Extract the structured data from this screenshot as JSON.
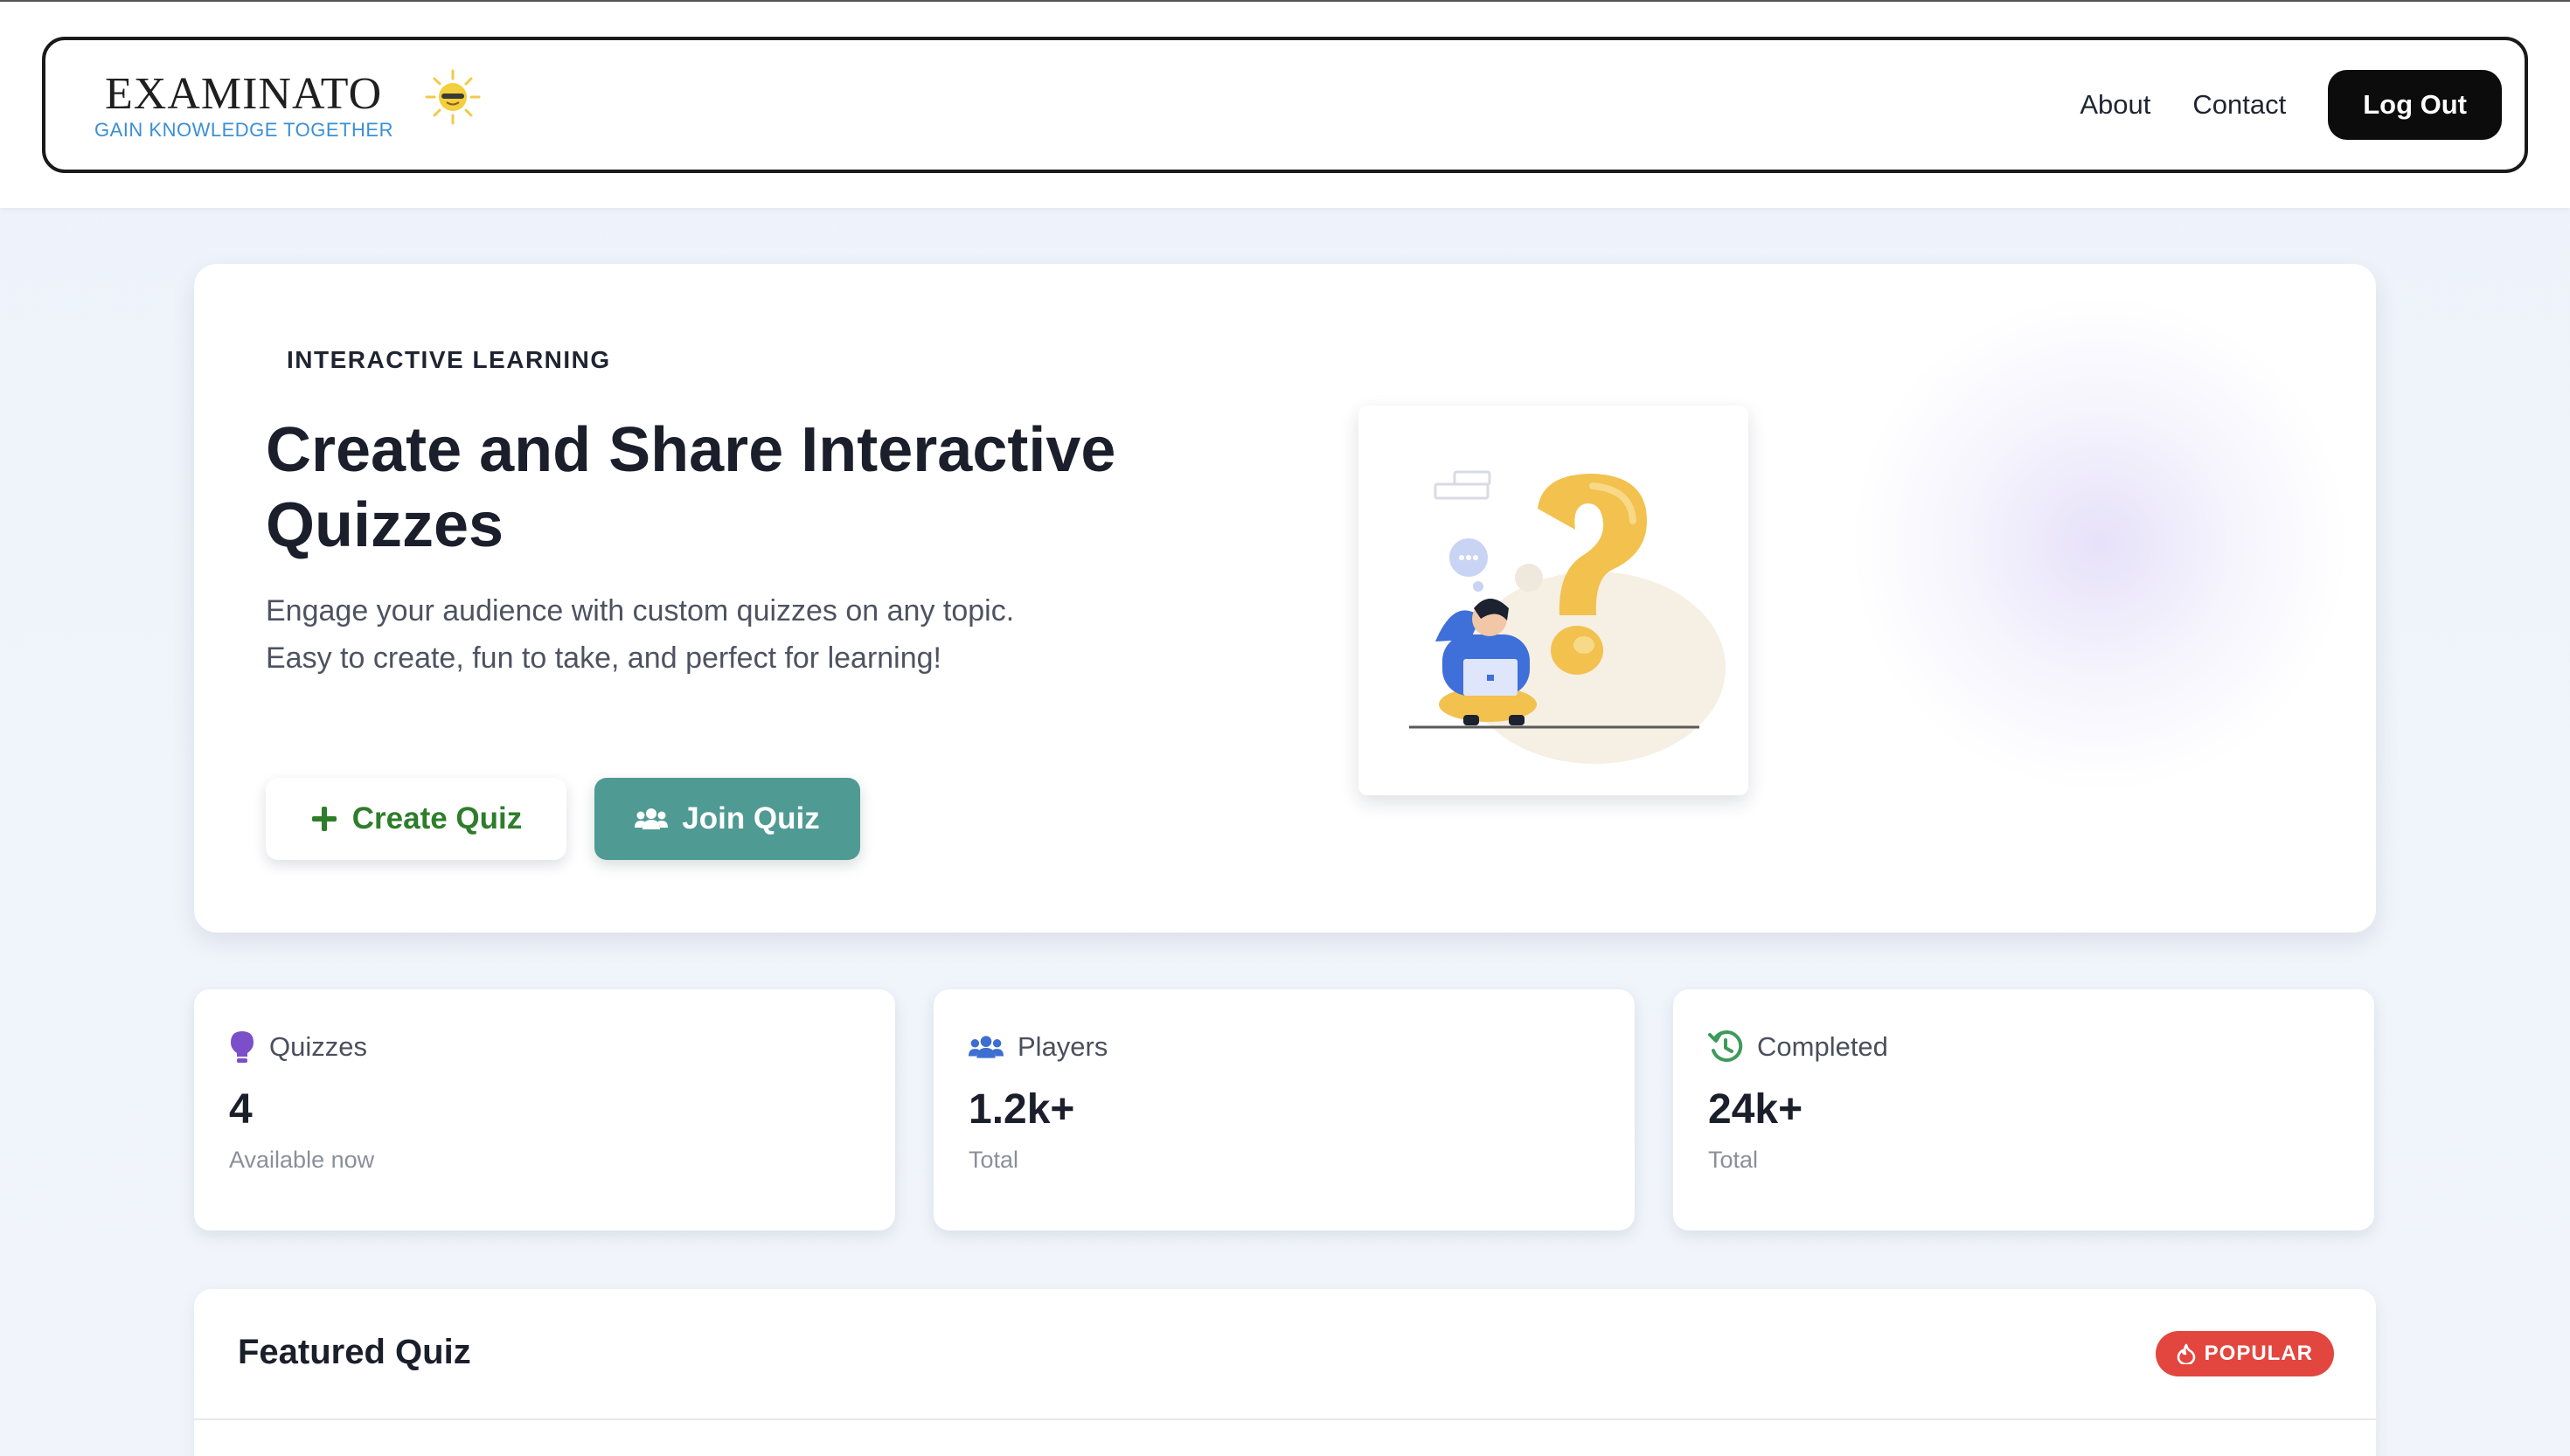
{
  "header": {
    "logo_title": "EXAMINATO",
    "logo_tagline": "GAIN KNOWLEDGE TOGETHER",
    "nav": [
      {
        "label": "About"
      },
      {
        "label": "Contact"
      }
    ],
    "logout_label": "Log Out"
  },
  "hero": {
    "eyebrow": "INTERACTIVE LEARNING",
    "title": "Create and Share Interactive Quizzes",
    "description": "Engage your audience with custom quizzes on any topic. Easy to create, fun to take, and perfect for learning!",
    "create_label": "Create Quiz",
    "join_label": "Join Quiz",
    "illustration_icon": "question-mark-illustration"
  },
  "stats": [
    {
      "icon": "lightbulb-icon",
      "label": "Quizzes",
      "value": "4",
      "sub": "Available now",
      "icon_color": "#7b4fc9"
    },
    {
      "icon": "users-icon",
      "label": "Players",
      "value": "1.2k+",
      "sub": "Total",
      "icon_color": "#3d6fd1"
    },
    {
      "icon": "history-icon",
      "label": "Completed",
      "value": "24k+",
      "sub": "Total",
      "icon_color": "#3f9a5a"
    }
  ],
  "featured": {
    "title": "Featured Quiz",
    "badge": "POPULAR"
  },
  "colors": {
    "create_text": "#2e7d2b",
    "join_bg": "#4f9a93",
    "badge_bg": "#e2463f",
    "logo_tag": "#3b8fd4"
  }
}
